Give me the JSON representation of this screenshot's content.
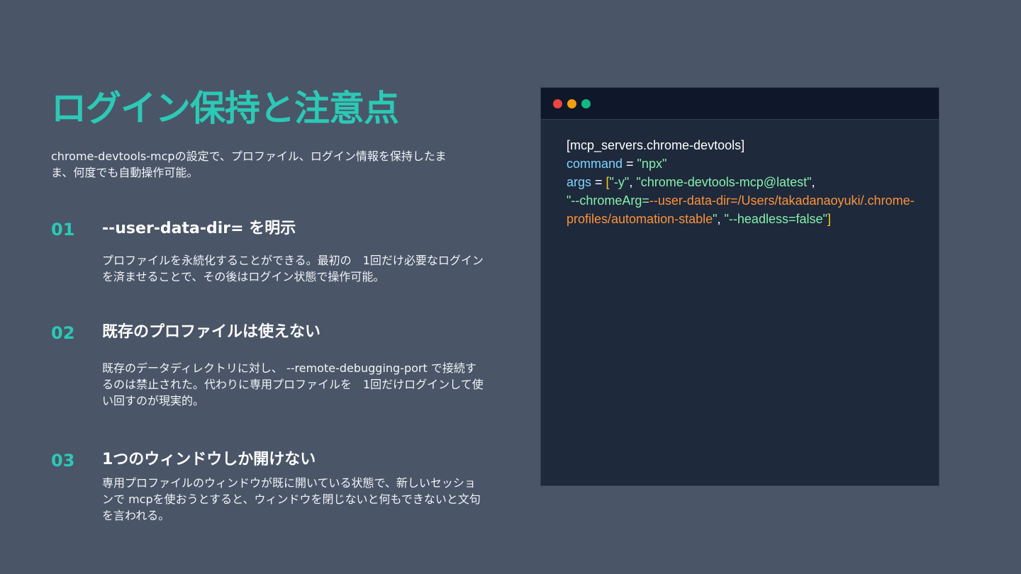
{
  "slide": {
    "title": "ログイン保持と注意点",
    "subtitle": "chrome-devtools-mcpの設定で、プロファイル、ログイン情報を保持したまま、何度でも自動操作可能。"
  },
  "items": [
    {
      "number": "01",
      "heading": "--user-data-dir= を明示",
      "description": "プロファイルを永続化することができる。最初の　1回だけ必要なログインを済ませることで、その後はログイン状態で操作可能。"
    },
    {
      "number": "02",
      "heading": "既存のプロファイルは使えない",
      "description": "既存のデータディレクトリに対し、 --remote-debugging-port で接続するのは禁止された。代わりに専用プロファイルを　1回だけログインして使い回すのが現実的。"
    },
    {
      "number": "03",
      "heading": "1つのウィンドウしか開けない",
      "description": "専用プロファイルのウィンドウが既に開いている状態で、新しいセッションで mcpを使おうとすると、ウィンドウを閉じないと何もできないと文句を言われる。"
    }
  ],
  "terminal": {
    "section": "[mcp_servers.chrome-devtools]",
    "command_key": "command",
    "equals": " = ",
    "command_value": "\"npx\"",
    "args_key": "args",
    "bracket_open": "[",
    "bracket_close": "]",
    "comma": ", ",
    "arg1": "\"-y\"",
    "arg2": "\"chrome-devtools-mcp@latest\"",
    "arg3_prefix": "\"--chromeArg=",
    "arg3_path": "--user-data-dir=/Users/takadanaoyuki/.chrome-profiles/automation-stable",
    "arg3_suffix": "\"",
    "arg4": "\"--headless=false\""
  },
  "colors": {
    "accent": "#2cc9b4",
    "background": "#4a5568",
    "terminal_bg": "#1e293b",
    "terminal_bar": "#0f172a",
    "key": "#7dd3fc",
    "string": "#86efac",
    "path": "#fb923c",
    "bracket": "#facc15"
  },
  "icons": [
    "close-dot-icon",
    "minimize-dot-icon",
    "maximize-dot-icon"
  ]
}
